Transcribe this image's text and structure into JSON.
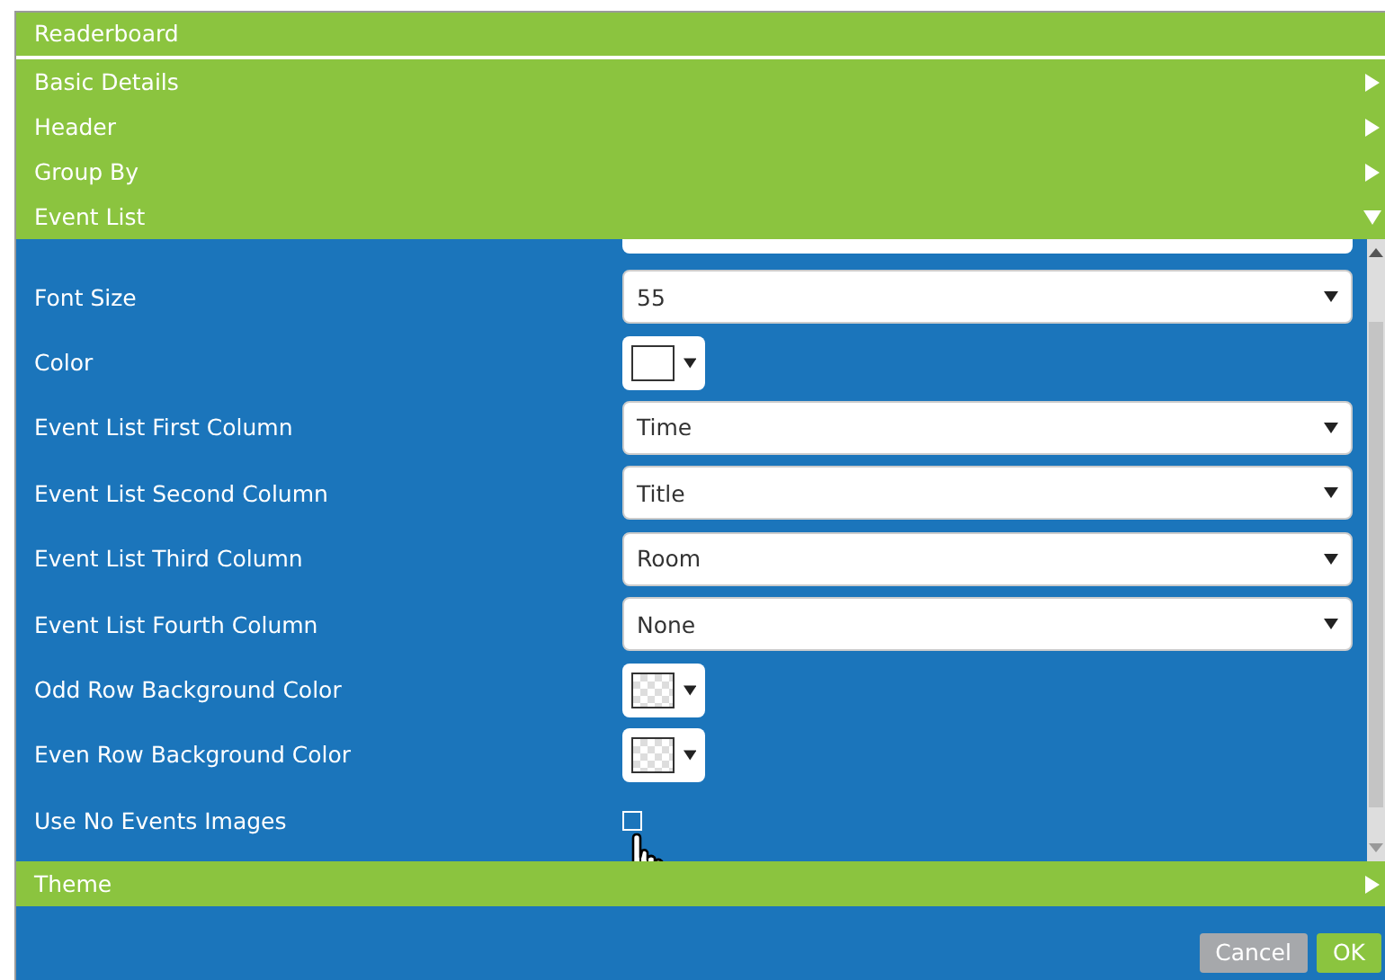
{
  "window": {
    "title": "Readerboard"
  },
  "sections_before": [
    {
      "label": "Basic Details",
      "expanded": false
    },
    {
      "label": "Header",
      "expanded": false
    },
    {
      "label": "Group By",
      "expanded": false
    },
    {
      "label": "Event List",
      "expanded": true
    }
  ],
  "fields": [
    {
      "kind": "select",
      "label": "Font Size",
      "value": "55"
    },
    {
      "kind": "color",
      "label": "Color",
      "transparent": false
    },
    {
      "kind": "select",
      "label": "Event List First Column",
      "value": "Time"
    },
    {
      "kind": "select",
      "label": "Event List Second Column",
      "value": "Title"
    },
    {
      "kind": "select",
      "label": "Event List Third Column",
      "value": "Room"
    },
    {
      "kind": "select",
      "label": "Event List Fourth Column",
      "value": "None"
    },
    {
      "kind": "color",
      "label": "Odd Row Background Color",
      "transparent": true
    },
    {
      "kind": "color",
      "label": "Even Row Background Color",
      "transparent": true
    },
    {
      "kind": "checkbox",
      "label": "Use No Events Images",
      "checked": false
    }
  ],
  "sections_after": [
    {
      "label": "Theme",
      "expanded": false
    }
  ],
  "buttons": [
    {
      "label": "Cancel",
      "kind": "secondary"
    },
    {
      "label": "OK",
      "kind": "primary"
    }
  ]
}
